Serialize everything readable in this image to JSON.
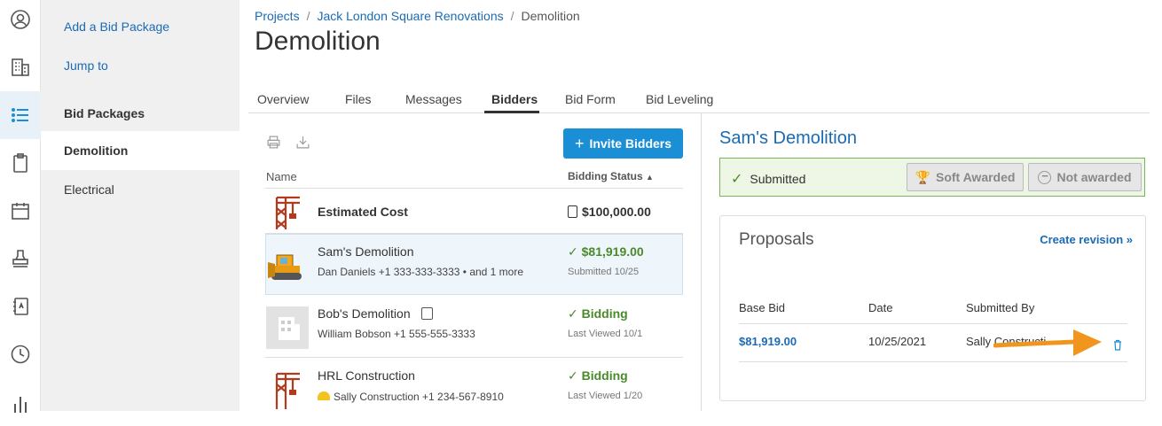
{
  "rail": [
    "user-icon",
    "building-icon",
    "list-icon",
    "clipboard-icon",
    "calendar-icon",
    "stamp-icon",
    "notebook-icon",
    "clock-icon",
    "bar-chart-icon"
  ],
  "sidebar": {
    "add_bid_package": "Add a Bid Package",
    "jump_to": "Jump to",
    "section_header": "Bid Packages",
    "items": [
      "Demolition",
      "Electrical"
    ]
  },
  "breadcrumb": {
    "projects": "Projects",
    "project": "Jack London Square Renovations",
    "current": "Demolition"
  },
  "page_title": "Demolition",
  "tabs": [
    "Overview",
    "Files",
    "Messages",
    "Bidders",
    "Bid Form",
    "Bid Leveling"
  ],
  "bidders": {
    "invite_label": "Invite Bidders",
    "col_name": "Name",
    "col_status": "Bidding Status",
    "rows": [
      {
        "name": "Estimated Cost",
        "contact": "",
        "status": "$100,000.00",
        "substatus": ""
      },
      {
        "name": "Sam's Demolition",
        "contact": "Dan Daniels +1 333-333-3333 • and 1 more",
        "status": "$81,919.00",
        "substatus": "Submitted 10/25"
      },
      {
        "name": "Bob's Demolition",
        "contact": "William Bobson +1 555-555-3333",
        "status": "Bidding",
        "substatus": "Last Viewed 10/1"
      },
      {
        "name": "HRL Construction",
        "contact": "Sally Construction +1 234-567-8910",
        "status": "Bidding",
        "substatus": "Last Viewed 1/20"
      }
    ]
  },
  "detail": {
    "title": "Sam's Demolition",
    "submitted": "Submitted",
    "soft_awarded": "Soft Awarded",
    "not_awarded": "Not awarded",
    "proposals_title": "Proposals",
    "create_revision": "Create revision »",
    "headers": [
      "Base Bid",
      "Date",
      "Submitted By"
    ],
    "proposal": {
      "base_bid": "$81,919.00",
      "date": "10/25/2021",
      "submitted_by": "Sally Constructi"
    }
  },
  "colors": {
    "accent": "#1a6bb3",
    "button": "#1a8fd6",
    "success": "#4a8a2a",
    "arrow": "#f0961e"
  }
}
